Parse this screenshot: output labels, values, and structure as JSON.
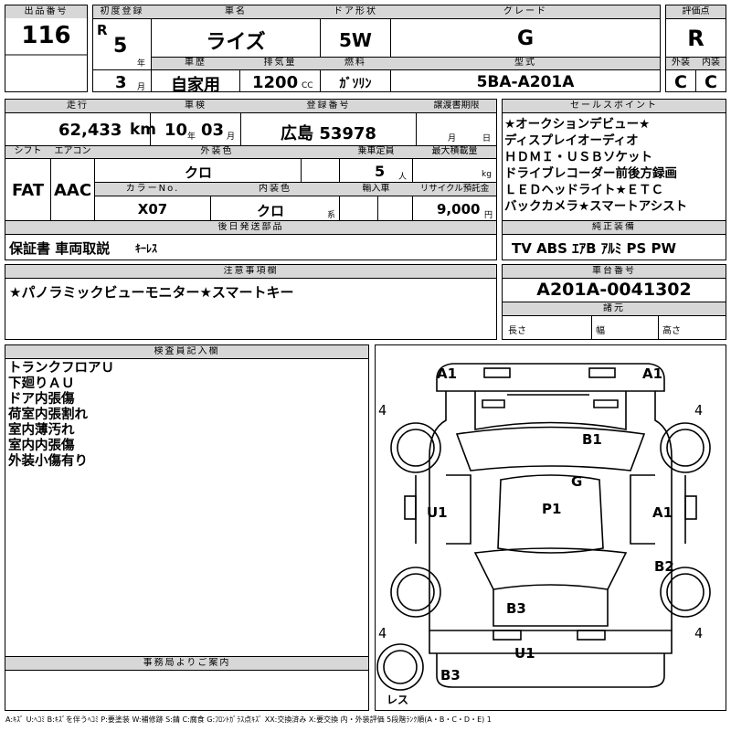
{
  "top": {
    "lot_label": "出品番号",
    "lot": "116",
    "first_reg_label": "初度登録",
    "era": "R",
    "year": "5",
    "year_unit": "年",
    "month": "3",
    "month_unit": "月",
    "car_label": "車名",
    "car": "ライズ",
    "door_label": "ドア形状",
    "door": "5W",
    "grade_label": "グレード",
    "grade": "G",
    "score_label": "評価点",
    "score": "R",
    "history_label": "車歴",
    "history": "自家用",
    "displacement_label": "排気量",
    "displacement": "1200",
    "cc": "CC",
    "fuel_label": "燃料",
    "fuel": "ｶﾞｿﾘﾝ",
    "model_label": "型式",
    "model": "5BA-A201A",
    "ext_label": "外装",
    "ext": "C",
    "int_label": "内装",
    "int": "C"
  },
  "row2": {
    "mileage_label": "走行",
    "mileage": "62,433",
    "km": "km",
    "inspection_label": "車検",
    "insp_year": "10",
    "insp_year_unit": "年",
    "insp_month": "03",
    "insp_month_unit": "月",
    "plate_label": "登録番号",
    "plate": "広島 53978",
    "transfer_label": "譲渡書期限",
    "transfer_month": "月",
    "transfer_day": "日",
    "sales_label": "セールスポイント",
    "sales_points": [
      "★オークションデビュー★",
      "ディスプレイオーディオ",
      "ＨＤＭＩ・ＵＳＢソケット",
      "ドライブレコーダー前後方録画",
      "ＬＥＤヘッドライト★ＥＴＣ",
      "バックカメラ★スマートアシスト"
    ]
  },
  "row3": {
    "shift_label": "シフト",
    "shift": "FAT",
    "ac_label": "エアコン",
    "ac": "AAC",
    "ext_color_label": "外装色",
    "ext_color": "クロ",
    "capacity_label": "乗車定員",
    "capacity": "5",
    "capacity_unit": "人",
    "max_load_label": "最大積載量",
    "kg": "kg",
    "color_no_label": "カラーNo.",
    "color_no": "X07",
    "int_color_label": "内装色",
    "int_color": "クロ",
    "int_color_unit": "系",
    "import_label": "輸入車",
    "recycle_label": "リサイクル預託金",
    "recycle": "9,000",
    "yen": "円"
  },
  "parts": {
    "label": "後日発送部品",
    "value": "保証書 車両取説",
    "extra": "ｷｰﾚｽ"
  },
  "equipment": {
    "label": "純正装備",
    "value": "TV ABS ｴｱB ｱﾙﾐ PS PW"
  },
  "notes": {
    "label": "注意事項欄",
    "value": "★パノラミックビューモニター★スマートキー"
  },
  "chassis": {
    "label": "車台番号",
    "value": "A201A-0041302"
  },
  "specs": {
    "label": "諸元",
    "length": "長さ",
    "width": "幅",
    "height": "高さ"
  },
  "inspector": {
    "label": "検査員記入欄",
    "lines": [
      "トランクフロアＵ",
      "下廻りＡＵ",
      "ドア内張傷",
      "荷室内張割れ",
      "室内薄汚れ",
      "室内内張傷",
      "外装小傷有り"
    ]
  },
  "office": {
    "label": "事務局よりご案内"
  },
  "diagram": {
    "marks": [
      "A1",
      "A1",
      "4",
      "4",
      "B1",
      "G",
      "U1",
      "P1",
      "A1",
      "B2",
      "B3",
      "4",
      "4",
      "U1",
      "B3",
      "レス"
    ]
  },
  "legend": "A:ｷｽﾞ U:ﾍｺﾐ B:ｷｽﾞを伴うﾍｺﾐ P:要塗装 W:補修跡 S:錆 C:腐食 G:ﾌﾛﾝﾄｶﾞﾗｽ点ｷｽﾞ XX:交換済み X:要交換  内・外装評価 5段階ﾗﾝｸ順(A・B・C・D・E) 1"
}
